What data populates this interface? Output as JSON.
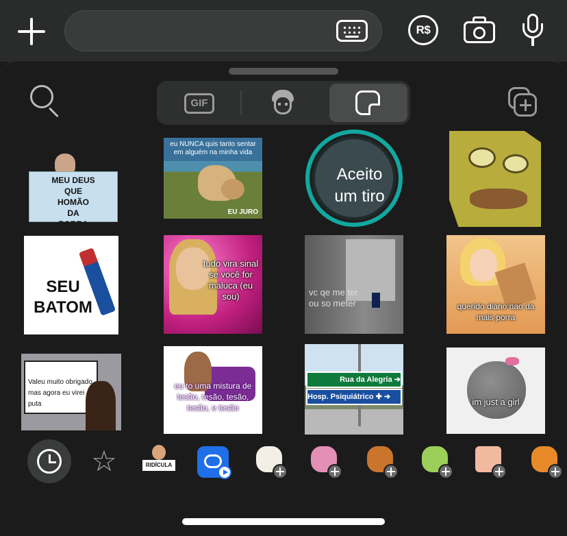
{
  "composer": {
    "message_value": "",
    "currency_label": "R$"
  },
  "icons": {
    "add": "plus-icon",
    "keyboard": "keyboard-icon",
    "currency": "payment-icon",
    "camera": "camera-icon",
    "mic": "microphone-icon",
    "search": "search-icon",
    "add_sticker": "add-sticker-icon",
    "recent": "clock-icon",
    "favorites": "star-icon"
  },
  "tabs": {
    "gif_label": "GIF",
    "avatar_icon": "avatar-icon",
    "sticker_icon": "sticker-icon",
    "selected": "sticker"
  },
  "stickers": [
    {
      "caption": "MEU DEUS\nQUE\nHOMÃO\nDA\nPORRA"
    },
    {
      "caption": "eu NUNCA quis tanto sentar em alguém na minha vida",
      "tag": "EU JURO"
    },
    {
      "caption": "Aceito\num tiro"
    },
    {
      "caption": ""
    },
    {
      "caption": "SEU\nBATOM"
    },
    {
      "caption": "tudo vira sinal se você for maluca (eu sou)"
    },
    {
      "caption": "vc qe me ter\nou so meter"
    },
    {
      "caption": "querido diário nao da mais porra"
    },
    {
      "caption": "Valeu muito obrigado\nmas agora eu virei puta"
    },
    {
      "caption": "eu to uma mistura de tesão, tesão, tesão, tesão, e tesão"
    },
    {
      "caption": "Rua da Alegria ➔",
      "caption2": "Hosp. Psiquiátrico ✚ ➔"
    },
    {
      "caption": "im just a girl"
    }
  ],
  "tray": {
    "ridicula_label": "RIDÍCULA",
    "packs": [
      "cup-sticker-pack",
      "toy-sticker-pack",
      "capybara-sticker-pack",
      "chef-sticker-pack",
      "photo-sticker-pack",
      "fruit-sticker-pack"
    ]
  },
  "colors": {
    "background": "#1b1b1b",
    "topbar": "#2a2b2b",
    "accent_teal": "#12a8a0",
    "selected_tab": "#4a4b4b"
  }
}
